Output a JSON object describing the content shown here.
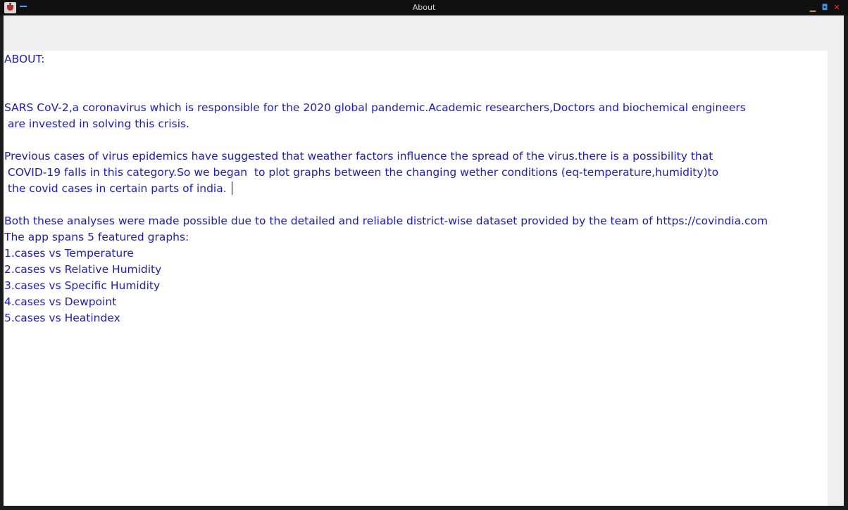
{
  "window": {
    "title": "About"
  },
  "titlebar_icons": {
    "app": "app-icon",
    "menu": "window-menu-icon",
    "minimize": "minimize-icon",
    "maximize": "maximize-icon",
    "close": "close-icon",
    "minimize_glyph": "▁",
    "maximize_glyph": "◘",
    "close_glyph": "✕"
  },
  "colors": {
    "text": "#1a1ad6",
    "minimize": "#f0c000",
    "maximize": "#33a0ff",
    "close": "#ff2a2a"
  },
  "content": {
    "lines": [
      "ABOUT:",
      "",
      "",
      "SARS CoV-2,a coronavirus which is responsible for the 2020 global pandemic.Academic researchers,Doctors and biochemical engineers",
      " are invested in solving this crisis.",
      "",
      "Previous cases of virus epidemics have suggested that weather factors influence the spread of the virus.there is a possibility that",
      " COVID-19 falls in this category.So we began  to plot graphs between the changing wether conditions (eq-temperature,humidity)to",
      " the covid cases in certain parts of india. ",
      "",
      "Both these analyses were made possible due to the detailed and reliable district-wise dataset provided by the team of https://covindia.com",
      "The app spans 5 featured graphs:",
      "1.cases vs Temperature",
      "2.cases vs Relative Humidity",
      "3.cases vs Specific Humidity",
      "4.cases vs Dewpoint",
      "5.cases vs Heatindex"
    ]
  }
}
